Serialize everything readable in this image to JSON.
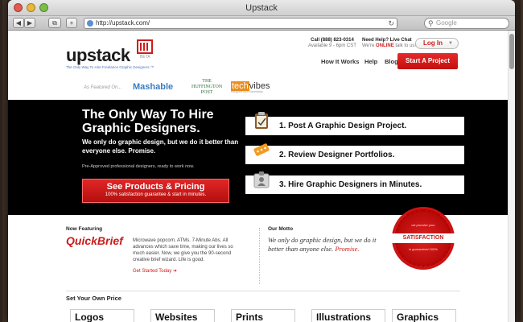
{
  "browser": {
    "title": "Upstack",
    "url": "http://upstack.com/",
    "search_placeholder": "Google",
    "back_label": "◀",
    "fwd_label": "▶",
    "tab_label": "⧉",
    "add_label": "+"
  },
  "header": {
    "logo": "upstack",
    "beta": "BETA",
    "tagline": "The Only Way To Hire Freelance Graphic Designers.™",
    "phone": "Call (888) 823-0314",
    "hours": "Available 9 - 6pm CST",
    "chat_title": "Need Help? Live Chat",
    "chat_pre": "We're",
    "chat_status": "ONLINE",
    "chat_post": "talk to us!",
    "login_label": "Log In",
    "nav": [
      "How It Works",
      "Help",
      "Blog"
    ],
    "start_label": "Start A Project"
  },
  "featured": {
    "label": "As Featured On...",
    "mashable": "Mashable",
    "huff_1": "THE",
    "huff_2": "HUFFINGTON",
    "huff_3": "POST",
    "tech_1": "tech",
    "tech_2": "vibes",
    "tech_sub": "riding the tech community"
  },
  "hero": {
    "title": "The Only Way To Hire Graphic Designers.",
    "subtitle": "We only do graphic design, but we do it better than everyone else. Promise.",
    "pre": "Pre-Approved professional designers, ready to work now.",
    "cta": "See Products & Pricing",
    "cta_sub": "100% satisfaction guarantee & start in minutes.",
    "steps": [
      "1. Post A Graphic Design Project.",
      "2. Review Designer Portfolios.",
      "3. Hire Graphic Designers in Minutes."
    ]
  },
  "feature": {
    "now": "Now Featuring",
    "name": "QuickBrief",
    "desc": "Microwave popcorn. ATMs. 7-Minute Abs. All advances which save time, making our lives so much easier. Now, we give you the 90-second creative brief wizard. Life is good.",
    "link": "Get Started Today ➜"
  },
  "motto": {
    "heading": "Our Motto",
    "text": "We only do graphic design, but we do it better than anyone else.",
    "promise": "Promise."
  },
  "seal": {
    "top": "we promise your",
    "mid": "SATISFACTION",
    "bottom": "is guaranteed 100%"
  },
  "pricing": {
    "heading": "Set Your Own Price",
    "tabs": [
      "Logos",
      "Websites",
      "Prints",
      "Illustrations",
      "Graphics"
    ]
  },
  "colors": {
    "accent": "#cc1c1c",
    "link_blue": "#3a7dc2"
  }
}
